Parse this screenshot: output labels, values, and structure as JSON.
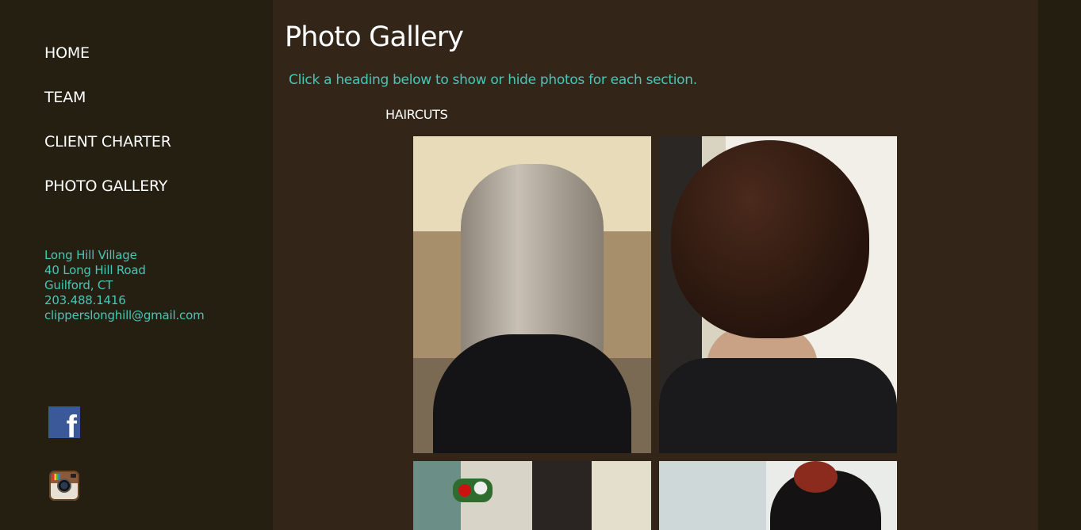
{
  "nav": {
    "items": [
      {
        "label": "HOME"
      },
      {
        "label": "TEAM"
      },
      {
        "label": "CLIENT CHARTER"
      },
      {
        "label": "PHOTO GALLERY"
      }
    ]
  },
  "contact": {
    "place": "Long Hill Village",
    "street": "40 Long Hill Road",
    "city": "Guilford, CT",
    "phone": "203.488.1416",
    "email": "clipperslonghill@gmail.com"
  },
  "social": {
    "facebook_icon": "facebook-icon",
    "instagram_icon": "instagram-icon"
  },
  "main": {
    "title": "Photo Gallery",
    "instruction": "Click a heading below to show or hide photos for each section.",
    "section_heading": "HAIRCUTS"
  },
  "colors": {
    "accent": "#46c7b7",
    "sidebar_bg": "#241f11",
    "main_bg": "#332618"
  }
}
